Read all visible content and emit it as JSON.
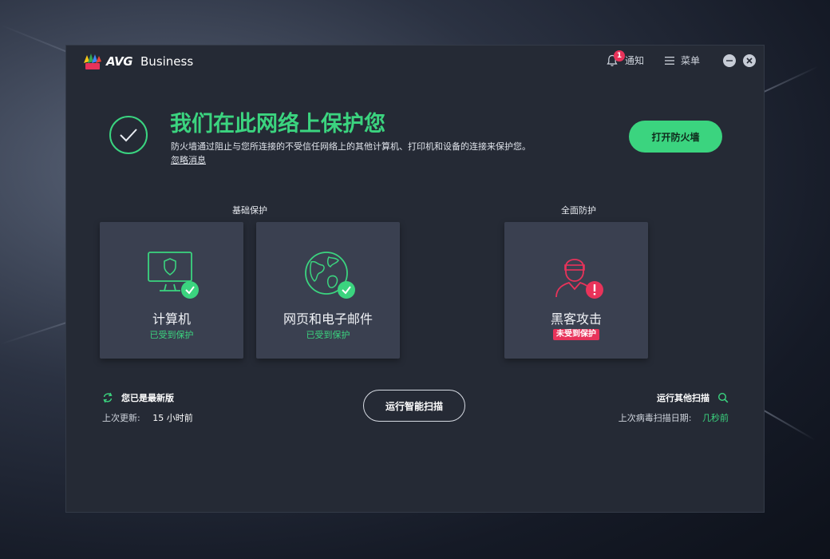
{
  "app": {
    "brand": "AVG",
    "product": "Business"
  },
  "titlebar": {
    "notifications_label": "通知",
    "notifications_count": "1",
    "menu_label": "菜单"
  },
  "banner": {
    "title": "我们在此网络上保护您",
    "description": "防火墙通过阻止与您所连接的不受信任网络上的其他计算机、打印机和设备的连接来保护您。",
    "dismiss_link": "忽略消息",
    "action_button": "打开防火墙"
  },
  "sections": {
    "basic": "基础保护",
    "full": "全面防护"
  },
  "cards": [
    {
      "title": "计算机",
      "status": "已受到保护",
      "icon": "computer-shield-icon",
      "state": "protected"
    },
    {
      "title": "网页和电子邮件",
      "status": "已受到保护",
      "icon": "globe-icon",
      "state": "protected"
    },
    {
      "title": "黑客攻击",
      "status": "未受到保护",
      "icon": "hacker-icon",
      "state": "unprotected"
    }
  ],
  "update": {
    "title": "您已是最新版",
    "last_update_label": "上次更新:",
    "last_update_value": "15 小时前"
  },
  "scan": {
    "smart_scan_button": "运行智能扫描",
    "other_scans_link": "运行其他扫描",
    "last_scan_label": "上次病毒扫描日期:",
    "last_scan_value": "几秒前"
  },
  "colors": {
    "accent_green": "#3bd47f",
    "alert_red": "#e8335a",
    "window_bg": "#252a35",
    "card_bg": "#3a4050"
  }
}
